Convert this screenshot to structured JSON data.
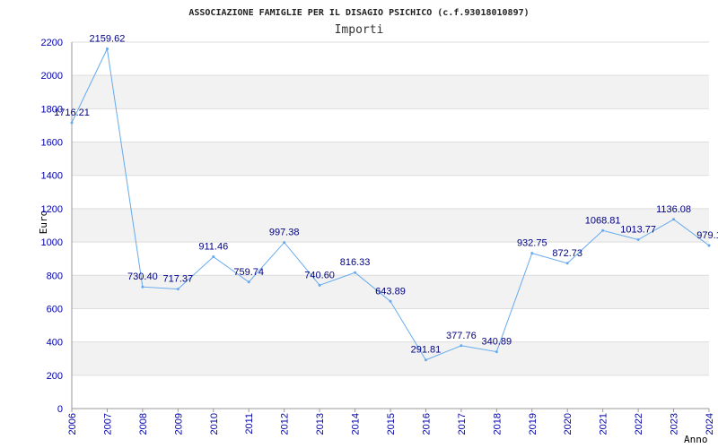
{
  "chart_data": {
    "type": "line",
    "title": "ASSOCIAZIONE FAMIGLIE PER IL DISAGIO PSICHICO (c.f.93018010897)",
    "subtitle": "Importi",
    "xlabel": "Anno",
    "ylabel": "Euro",
    "x": [
      "2006",
      "2007",
      "2008",
      "2009",
      "2010",
      "2011",
      "2012",
      "2013",
      "2014",
      "2015",
      "2016",
      "2017",
      "2018",
      "2019",
      "2020",
      "2021",
      "2022",
      "2023",
      "2024"
    ],
    "series": [
      {
        "values": [
          1716.21,
          2159.62,
          730.4,
          717.37,
          911.46,
          759.74,
          997.38,
          740.6,
          816.33,
          643.89,
          291.81,
          377.76,
          340.89,
          932.75,
          872.73,
          1068.81,
          1013.77,
          1136.08,
          979.1
        ],
        "labels": [
          "1716.21",
          "2159.62",
          "730.40",
          "717.37",
          "911.46",
          "759.74",
          "997.38",
          "740.60",
          "816.33",
          "643.89",
          "291.81",
          "377.76",
          "340.89",
          "932.75",
          "872.73",
          "1068.81",
          "1013.77",
          "1136.08",
          "979.1"
        ]
      }
    ],
    "ylim": [
      0,
      2200
    ],
    "yticks": [
      0,
      200,
      400,
      600,
      800,
      1000,
      1200,
      1400,
      1600,
      1800,
      2000,
      2200
    ],
    "grid": true,
    "line_color": "#66aaee",
    "band_color": "#f2f2f2",
    "tick_color": "#0000aa",
    "label_color": "#000080"
  }
}
